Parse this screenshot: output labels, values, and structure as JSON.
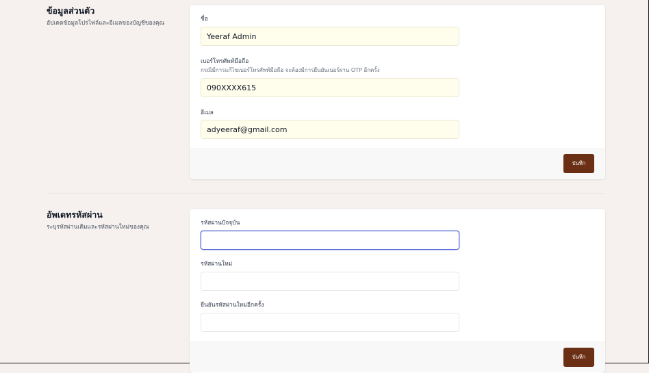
{
  "profile": {
    "title": "ข้อมูลส่วนตัว",
    "subtitle": "อัปเดตข้อมูลโปรไฟล์และอีเมลของบัญชีของคุณ",
    "name_label": "ชื่อ",
    "name_value": "Yeeraf Admin",
    "phone_label": "เบอร์โทรศัพท์มือถือ",
    "phone_help": "กรณีมีการแก้ไขเบอร์โทรศัพท์มือถือ จะต้องมีการยืนยันเบอร์ผ่าน OTP อีกครั้ง",
    "phone_value": "090XXXX615",
    "email_label": "อีเมล",
    "email_value": "adyeeraf@gmail.com",
    "save_label": "บันทึก"
  },
  "password": {
    "title": "อัพเดทรหัสผ่าน",
    "subtitle": "ระบุรหัสผ่านเดิมและรหัสผ่านใหม่ของคุณ",
    "current_label": "รหัสผ่านปัจจุบัน",
    "current_value": "",
    "new_label": "รหัสผ่านใหม่",
    "new_value": "",
    "confirm_label": "ยืนยันรหัสผ่านใหม่อีกครั้ง",
    "confirm_value": "",
    "save_label": "บันทึก"
  },
  "colors": {
    "page_bg": "#f6f1ee",
    "button_bg": "#6b2f16",
    "autofill_bg": "#fffdeb",
    "focus_border": "#5b6fd6"
  }
}
